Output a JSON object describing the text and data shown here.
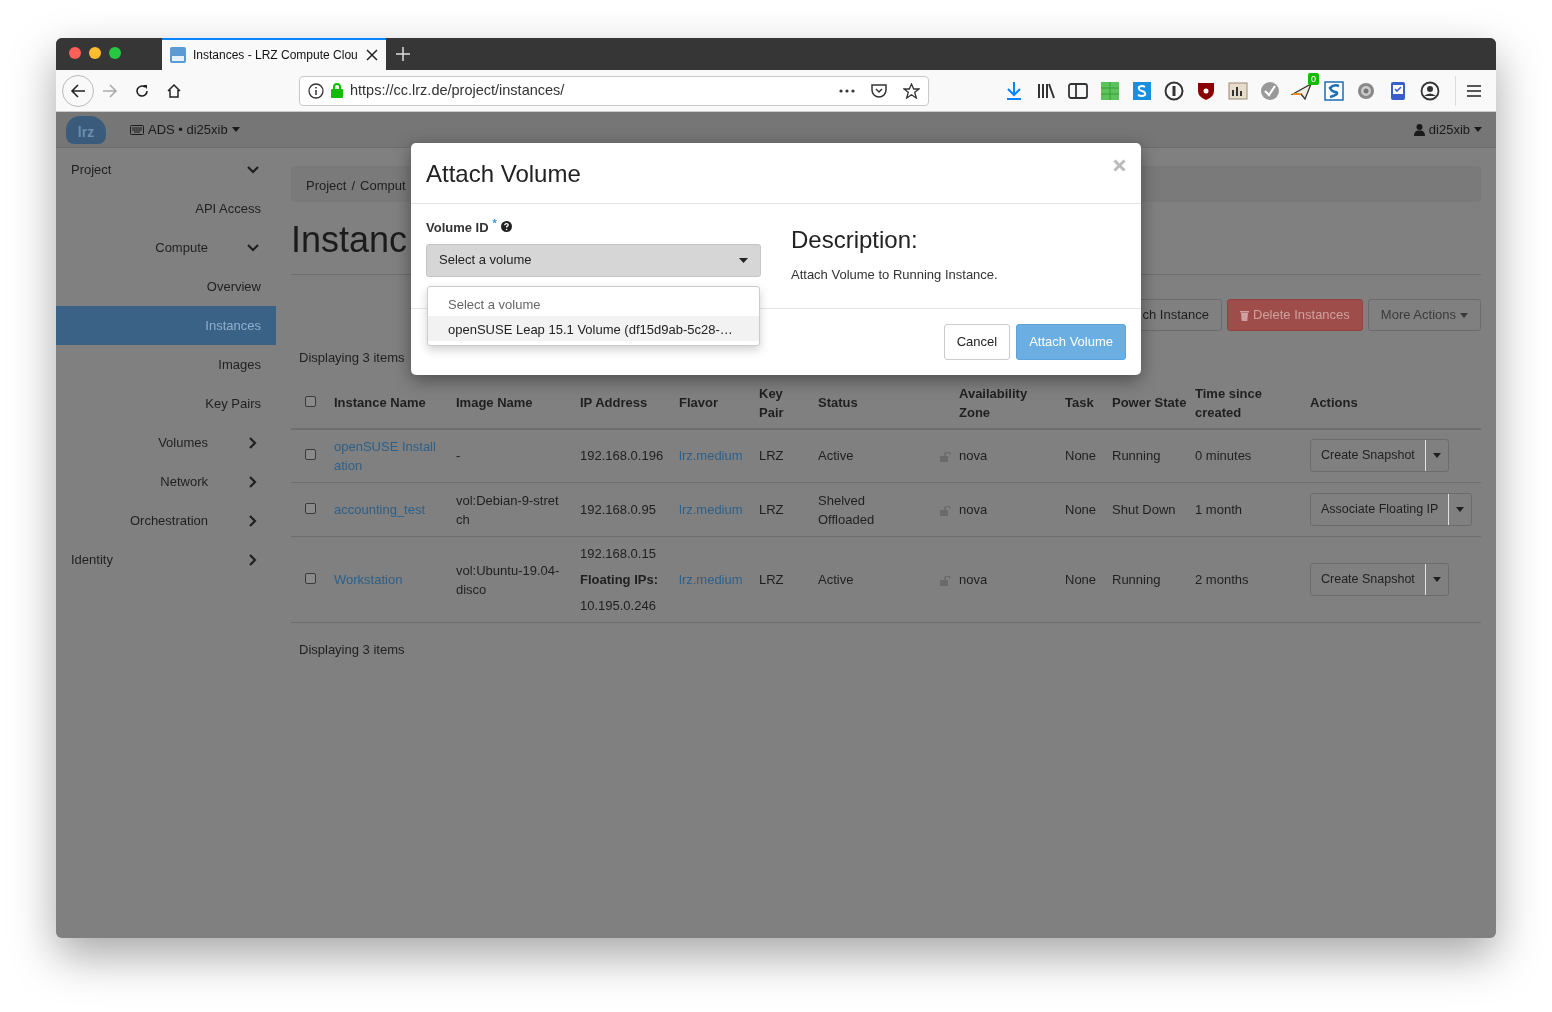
{
  "browser": {
    "tab_title": "Instances - LRZ Compute Clou",
    "url": "https://cc.lrz.de/project/instances/",
    "extension_badge": "0"
  },
  "app_header": {
    "logo": "lrz",
    "project": "ADS • di25xib",
    "user": "di25xib"
  },
  "sidebar": {
    "items": [
      {
        "label": "Project",
        "expanded": true,
        "children": [
          {
            "label": "API Access",
            "selected": false
          },
          {
            "label": "Compute",
            "expanded": true,
            "children": [
              {
                "label": "Overview",
                "selected": false
              },
              {
                "label": "Instances",
                "selected": true
              },
              {
                "label": "Images",
                "selected": false
              },
              {
                "label": "Key Pairs",
                "selected": false
              }
            ]
          },
          {
            "label": "Volumes",
            "expanded": false
          },
          {
            "label": "Network",
            "expanded": false
          },
          {
            "label": "Orchestration",
            "expanded": false
          }
        ]
      },
      {
        "label": "Identity",
        "expanded": false
      }
    ]
  },
  "breadcrumb": [
    {
      "label": "Project",
      "separator": "/"
    },
    {
      "label": "Comput"
    }
  ],
  "page_title": "Instanc",
  "actions": [
    {
      "label": "ch Instance",
      "kind": "default"
    },
    {
      "label": "Delete Instances",
      "kind": "danger"
    },
    {
      "label": "More Actions",
      "kind": "dropdown"
    }
  ],
  "count_top": "Displaying 3 items",
  "table": {
    "columns": [
      "Instance Name",
      "Image Name",
      "IP Address",
      "Flavor",
      "Key Pair",
      "Status",
      "Availability Zone",
      "Task",
      "Power State",
      "Time since created",
      "Actions"
    ],
    "header_checked": false,
    "rows": [
      {
        "checked": false,
        "name": "openSUSE Install ation",
        "image": "-",
        "ip": "192.168.0.196",
        "flavor": "lrz.medium",
        "key_pair": "LRZ",
        "status": "Active",
        "zone": "nova",
        "task": "None",
        "power": "Running",
        "age": "0 minutes",
        "action": "Create Snapshot"
      },
      {
        "checked": false,
        "name": "accounting_test",
        "image": "vol:Debian-9-stret ch",
        "ip": "192.168.0.95",
        "flavor": "lrz.medium",
        "key_pair": "LRZ",
        "status": "Shelved Offloaded",
        "zone": "nova",
        "task": "None",
        "power": "Shut Down",
        "age": "1 month",
        "action": "Associate Floating IP"
      },
      {
        "checked": false,
        "name": "Workstation",
        "image": "vol:Ubuntu-19.04- disco",
        "ip": "192.168.0.15",
        "floating_label": "Floating IPs:",
        "floating_ip": "10.195.0.246",
        "flavor": "lrz.medium",
        "key_pair": "LRZ",
        "status": "Active",
        "zone": "nova",
        "task": "None",
        "power": "Running",
        "age": "2 months",
        "action": "Create Snapshot"
      }
    ]
  },
  "count_bottom": "Displaying 3 items",
  "modal": {
    "title": "Attach Volume",
    "field_label": "Volume ID",
    "required_mark": "*",
    "select_value": "Select a volume",
    "dropdown_open": true,
    "options": [
      {
        "label": "Select a volume",
        "selected": false,
        "disabled": true
      },
      {
        "label": "openSUSE Leap 15.1 Volume (df15d9ab-5c28-…",
        "selected": true,
        "disabled": false
      }
    ],
    "description_heading": "Description:",
    "description": "Attach Volume to Running Instance.",
    "buttons": [
      {
        "label": "Cancel",
        "kind": "default"
      },
      {
        "label": "Attach Volume",
        "kind": "primary"
      }
    ]
  }
}
